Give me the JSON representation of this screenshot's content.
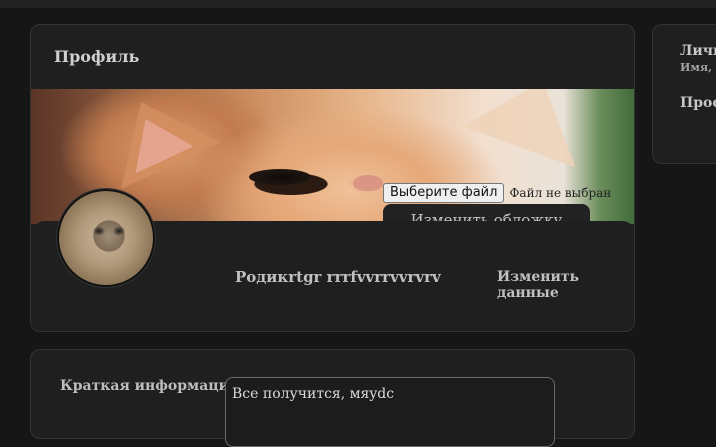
{
  "profile": {
    "title": "Профиль",
    "cover": {
      "file_button_label": "Выберите файл",
      "file_status": "Файл не выбран",
      "change_cover_label": "Изменить обложку"
    },
    "user_name": "Родикrtgr rrrfvvrrvvrvrv",
    "edit_label": "Изменить данные"
  },
  "side": {
    "title": "Личн",
    "subtitle": "Имя, ф",
    "title2": "Профи"
  },
  "info": {
    "label": "Краткая информация:",
    "value": "Все получится, мяydc"
  }
}
